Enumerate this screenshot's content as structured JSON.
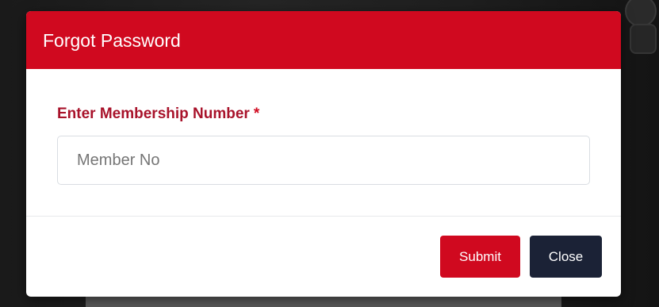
{
  "modal": {
    "title": "Forgot Password",
    "field_label": "Enter Membership Number",
    "required_marker": "*",
    "input": {
      "value": "",
      "placeholder": "Member No"
    },
    "buttons": {
      "submit_label": "Submit",
      "close_label": "Close"
    }
  },
  "colors": {
    "header_bg": "#d0091f",
    "label_text": "#a8122a",
    "submit_bg": "#d0091f",
    "close_bg": "#1b2236"
  }
}
